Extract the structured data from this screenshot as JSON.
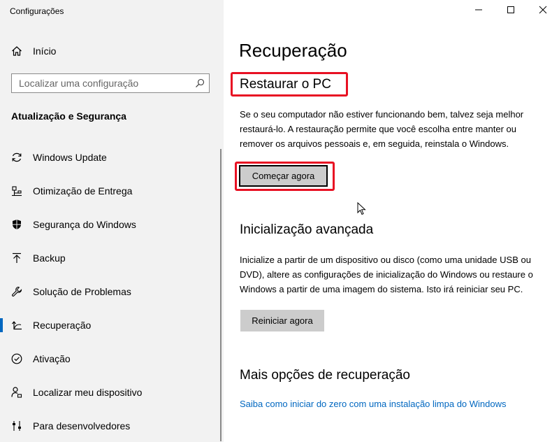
{
  "app_title": "Configurações",
  "sidebar": {
    "home_label": "Início",
    "search_placeholder": "Localizar uma configuração",
    "section_title": "Atualização e Segurança",
    "items": [
      {
        "label": "Windows Update",
        "icon": "sync-icon"
      },
      {
        "label": "Otimização de Entrega",
        "icon": "delivery-optimization-icon"
      },
      {
        "label": "Segurança do Windows",
        "icon": "shield-icon"
      },
      {
        "label": "Backup",
        "icon": "backup-arrow-icon"
      },
      {
        "label": "Solução de Problemas",
        "icon": "wrench-icon"
      },
      {
        "label": "Recuperação",
        "icon": "recovery-icon",
        "selected": true
      },
      {
        "label": "Ativação",
        "icon": "check-circle-icon"
      },
      {
        "label": "Localizar meu dispositivo",
        "icon": "person-location-icon"
      },
      {
        "label": "Para desenvolvedores",
        "icon": "developer-sliders-icon"
      }
    ]
  },
  "main": {
    "title": "Recuperação",
    "reset": {
      "heading": "Restaurar o PC",
      "description": "Se o seu computador não estiver funcionando bem, talvez seja melhor restaurá-lo. A restauração permite que você escolha entre manter ou remover os arquivos pessoais e, em seguida, reinstala o Windows.",
      "button_label": "Começar agora"
    },
    "advanced": {
      "heading": "Inicialização avançada",
      "description": "Inicialize a partir de um dispositivo ou disco (como uma unidade USB ou DVD), altere as configurações de inicialização do Windows ou restaure o Windows a partir de uma imagem do sistema. Isto irá reiniciar seu PC.",
      "button_label": "Reiniciar agora"
    },
    "more": {
      "heading": "Mais opções de recuperação",
      "link": "Saiba como iniciar do zero com uma instalação limpa do Windows"
    }
  },
  "colors": {
    "accent": "#0067c0",
    "highlight": "#e81123",
    "sidebar_bg": "#f2f2f2",
    "button_bg": "#cccccc"
  }
}
